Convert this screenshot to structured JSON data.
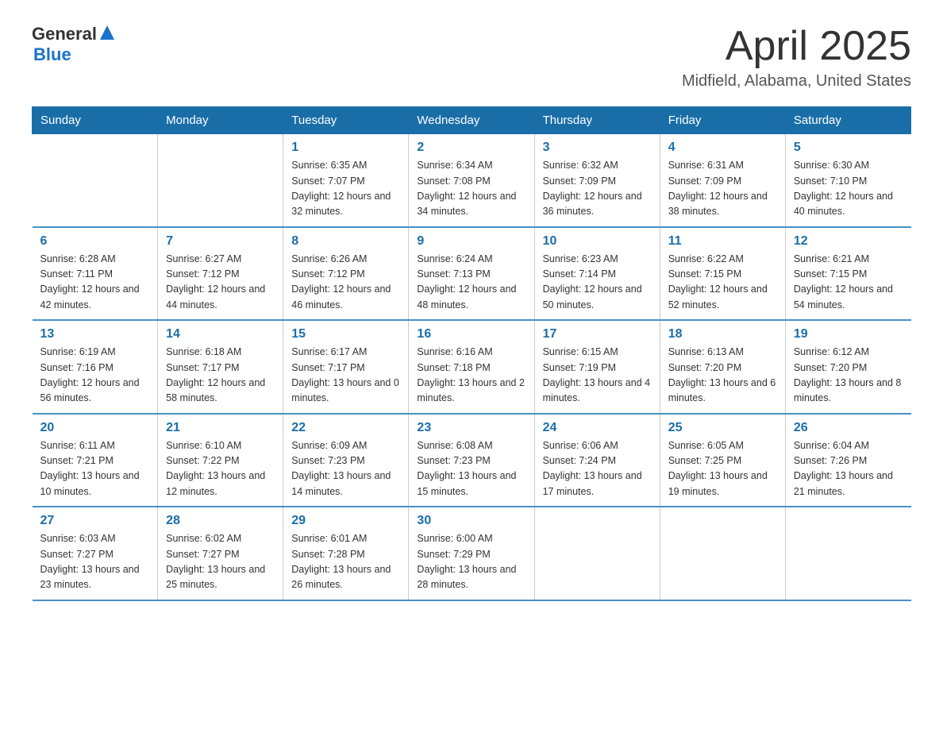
{
  "header": {
    "logo_general": "General",
    "logo_blue": "Blue",
    "month": "April 2025",
    "location": "Midfield, Alabama, United States"
  },
  "weekdays": [
    "Sunday",
    "Monday",
    "Tuesday",
    "Wednesday",
    "Thursday",
    "Friday",
    "Saturday"
  ],
  "weeks": [
    [
      {
        "day": "",
        "info": ""
      },
      {
        "day": "",
        "info": ""
      },
      {
        "day": "1",
        "info": "Sunrise: 6:35 AM\nSunset: 7:07 PM\nDaylight: 12 hours\nand 32 minutes."
      },
      {
        "day": "2",
        "info": "Sunrise: 6:34 AM\nSunset: 7:08 PM\nDaylight: 12 hours\nand 34 minutes."
      },
      {
        "day": "3",
        "info": "Sunrise: 6:32 AM\nSunset: 7:09 PM\nDaylight: 12 hours\nand 36 minutes."
      },
      {
        "day": "4",
        "info": "Sunrise: 6:31 AM\nSunset: 7:09 PM\nDaylight: 12 hours\nand 38 minutes."
      },
      {
        "day": "5",
        "info": "Sunrise: 6:30 AM\nSunset: 7:10 PM\nDaylight: 12 hours\nand 40 minutes."
      }
    ],
    [
      {
        "day": "6",
        "info": "Sunrise: 6:28 AM\nSunset: 7:11 PM\nDaylight: 12 hours\nand 42 minutes."
      },
      {
        "day": "7",
        "info": "Sunrise: 6:27 AM\nSunset: 7:12 PM\nDaylight: 12 hours\nand 44 minutes."
      },
      {
        "day": "8",
        "info": "Sunrise: 6:26 AM\nSunset: 7:12 PM\nDaylight: 12 hours\nand 46 minutes."
      },
      {
        "day": "9",
        "info": "Sunrise: 6:24 AM\nSunset: 7:13 PM\nDaylight: 12 hours\nand 48 minutes."
      },
      {
        "day": "10",
        "info": "Sunrise: 6:23 AM\nSunset: 7:14 PM\nDaylight: 12 hours\nand 50 minutes."
      },
      {
        "day": "11",
        "info": "Sunrise: 6:22 AM\nSunset: 7:15 PM\nDaylight: 12 hours\nand 52 minutes."
      },
      {
        "day": "12",
        "info": "Sunrise: 6:21 AM\nSunset: 7:15 PM\nDaylight: 12 hours\nand 54 minutes."
      }
    ],
    [
      {
        "day": "13",
        "info": "Sunrise: 6:19 AM\nSunset: 7:16 PM\nDaylight: 12 hours\nand 56 minutes."
      },
      {
        "day": "14",
        "info": "Sunrise: 6:18 AM\nSunset: 7:17 PM\nDaylight: 12 hours\nand 58 minutes."
      },
      {
        "day": "15",
        "info": "Sunrise: 6:17 AM\nSunset: 7:17 PM\nDaylight: 13 hours\nand 0 minutes."
      },
      {
        "day": "16",
        "info": "Sunrise: 6:16 AM\nSunset: 7:18 PM\nDaylight: 13 hours\nand 2 minutes."
      },
      {
        "day": "17",
        "info": "Sunrise: 6:15 AM\nSunset: 7:19 PM\nDaylight: 13 hours\nand 4 minutes."
      },
      {
        "day": "18",
        "info": "Sunrise: 6:13 AM\nSunset: 7:20 PM\nDaylight: 13 hours\nand 6 minutes."
      },
      {
        "day": "19",
        "info": "Sunrise: 6:12 AM\nSunset: 7:20 PM\nDaylight: 13 hours\nand 8 minutes."
      }
    ],
    [
      {
        "day": "20",
        "info": "Sunrise: 6:11 AM\nSunset: 7:21 PM\nDaylight: 13 hours\nand 10 minutes."
      },
      {
        "day": "21",
        "info": "Sunrise: 6:10 AM\nSunset: 7:22 PM\nDaylight: 13 hours\nand 12 minutes."
      },
      {
        "day": "22",
        "info": "Sunrise: 6:09 AM\nSunset: 7:23 PM\nDaylight: 13 hours\nand 14 minutes."
      },
      {
        "day": "23",
        "info": "Sunrise: 6:08 AM\nSunset: 7:23 PM\nDaylight: 13 hours\nand 15 minutes."
      },
      {
        "day": "24",
        "info": "Sunrise: 6:06 AM\nSunset: 7:24 PM\nDaylight: 13 hours\nand 17 minutes."
      },
      {
        "day": "25",
        "info": "Sunrise: 6:05 AM\nSunset: 7:25 PM\nDaylight: 13 hours\nand 19 minutes."
      },
      {
        "day": "26",
        "info": "Sunrise: 6:04 AM\nSunset: 7:26 PM\nDaylight: 13 hours\nand 21 minutes."
      }
    ],
    [
      {
        "day": "27",
        "info": "Sunrise: 6:03 AM\nSunset: 7:27 PM\nDaylight: 13 hours\nand 23 minutes."
      },
      {
        "day": "28",
        "info": "Sunrise: 6:02 AM\nSunset: 7:27 PM\nDaylight: 13 hours\nand 25 minutes."
      },
      {
        "day": "29",
        "info": "Sunrise: 6:01 AM\nSunset: 7:28 PM\nDaylight: 13 hours\nand 26 minutes."
      },
      {
        "day": "30",
        "info": "Sunrise: 6:00 AM\nSunset: 7:29 PM\nDaylight: 13 hours\nand 28 minutes."
      },
      {
        "day": "",
        "info": ""
      },
      {
        "day": "",
        "info": ""
      },
      {
        "day": "",
        "info": ""
      }
    ]
  ]
}
